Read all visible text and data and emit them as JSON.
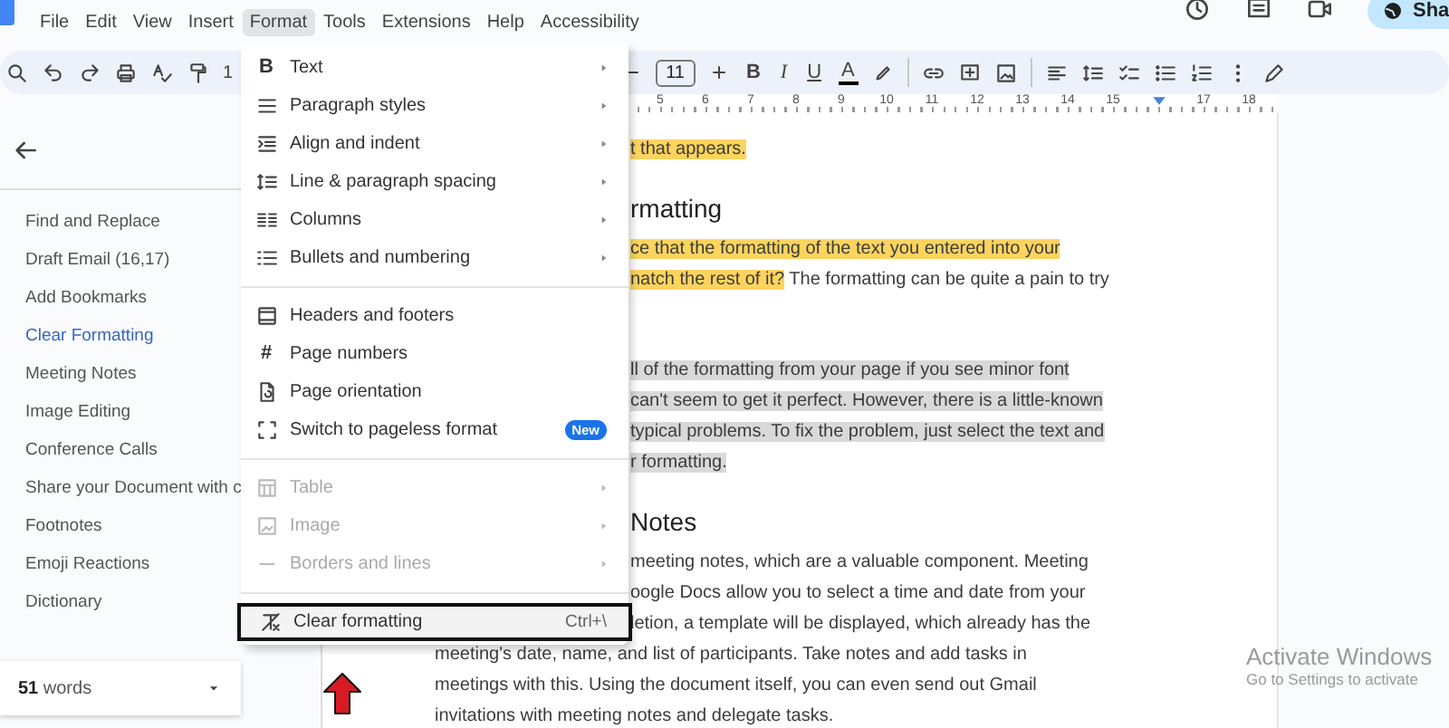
{
  "menubar": [
    {
      "label": "File",
      "selected": false
    },
    {
      "label": "Edit",
      "selected": false
    },
    {
      "label": "View",
      "selected": false
    },
    {
      "label": "Insert",
      "selected": false
    },
    {
      "label": "Format",
      "selected": true
    },
    {
      "label": "Tools",
      "selected": false
    },
    {
      "label": "Extensions",
      "selected": false
    },
    {
      "label": "Help",
      "selected": false
    },
    {
      "label": "Accessibility",
      "selected": false
    }
  ],
  "share": {
    "label": "Sha"
  },
  "toolbar": {
    "zoom": "1",
    "font_size": "11",
    "format_buttons": [
      "B",
      "I",
      "U",
      "A"
    ]
  },
  "ruler": [
    {
      "kind": "number",
      "label": "5"
    },
    {
      "kind": "number",
      "label": "6"
    },
    {
      "kind": "number",
      "label": "7"
    },
    {
      "kind": "number",
      "label": "8"
    },
    {
      "kind": "number",
      "label": "9"
    },
    {
      "kind": "number",
      "label": "10"
    },
    {
      "kind": "number",
      "label": "11"
    },
    {
      "kind": "number",
      "label": "12"
    },
    {
      "kind": "number",
      "label": "13"
    },
    {
      "kind": "number",
      "label": "14"
    },
    {
      "kind": "number",
      "label": "15"
    },
    {
      "kind": "marker"
    },
    {
      "kind": "number",
      "label": "17"
    },
    {
      "kind": "number",
      "label": "18"
    }
  ],
  "sidebar": {
    "items": [
      {
        "label": "Find and Replace",
        "selected": false
      },
      {
        "label": "Draft Email (16,17)",
        "selected": false
      },
      {
        "label": "Add Bookmarks",
        "selected": false
      },
      {
        "label": "Clear Formatting",
        "selected": true
      },
      {
        "label": "Meeting Notes",
        "selected": false
      },
      {
        "label": "Image Editing",
        "selected": false
      },
      {
        "label": "Conference Calls",
        "selected": false
      },
      {
        "label": "Share your Document with c",
        "selected": false
      },
      {
        "label": "Footnotes",
        "selected": false
      },
      {
        "label": "Emoji Reactions",
        "selected": false
      },
      {
        "label": "Dictionary",
        "selected": false
      }
    ],
    "word_count": "**51** words"
  },
  "document": {
    "beside_menu": [
      {
        "kind": "paragraph",
        "lines": [
          [
            {
              "text": "t that appears.",
              "highlighted": true,
              "selected": false
            }
          ]
        ]
      },
      {
        "kind": "heading",
        "lines": [
          [
            {
              "text": "rmatting",
              "highlighted": false,
              "selected": false
            }
          ]
        ]
      },
      {
        "kind": "paragraph",
        "lines": [
          [
            {
              "text": "ce that the formatting of the text you entered into your",
              "highlighted": true,
              "selected": false
            }
          ],
          [
            {
              "text": "natch the rest of it?",
              "highlighted": true,
              "selected": false
            },
            {
              "text": " The formatting can be quite a pain to try",
              "highlighted": false,
              "selected": false
            }
          ]
        ]
      },
      {
        "kind": "paragraph",
        "lines": [
          [
            {
              "text": "ll of the formatting from your page if you see minor font",
              "highlighted": false,
              "selected": true
            }
          ],
          [
            {
              "text": "can't seem to get it perfect. However, there is a little-known",
              "highlighted": false,
              "selected": true
            }
          ],
          [
            {
              "text": "typical problems. To fix the problem, just select the text and",
              "highlighted": false,
              "selected": true
            }
          ],
          [
            {
              "text": "r formatting.",
              "highlighted": false,
              "selected": true
            }
          ]
        ]
      },
      {
        "kind": "heading",
        "lines": [
          [
            {
              "text": "Notes",
              "highlighted": false,
              "selected": false
            }
          ]
        ]
      },
      {
        "kind": "paragraph",
        "lines": [
          [
            {
              "text": "meeting notes, which are a valuable component. Meeting",
              "highlighted": false,
              "selected": false
            }
          ],
          [
            {
              "text": "oogle Docs allow you to select a time and date from your",
              "highlighted": false,
              "selected": false
            }
          ],
          [
            {
              "text": "letion, a template will be displayed, which already has the",
              "highlighted": false,
              "selected": false
            }
          ]
        ]
      }
    ],
    "below_menu": [
      {
        "kind": "paragraph",
        "lines": [
          [
            {
              "text": "meeting's date, name, and list of participants. Take notes and add tasks in",
              "highlighted": false,
              "selected": false
            }
          ],
          [
            {
              "text": "meetings with this. Using the document itself, you can even send out Gmail",
              "highlighted": false,
              "selected": false
            }
          ],
          [
            {
              "text": "invitations with meeting notes and delegate tasks.",
              "highlighted": false,
              "selected": false
            }
          ]
        ]
      }
    ]
  },
  "format_menu": {
    "groups": [
      [
        {
          "label": "Text",
          "glyph": "B",
          "submenu": true,
          "disabled": false,
          "annotated": false
        },
        {
          "label": "Paragraph styles",
          "submenu": true,
          "disabled": false,
          "annotated": false
        },
        {
          "label": "Align and indent",
          "submenu": true,
          "disabled": false,
          "annotated": false
        },
        {
          "label": "Line & paragraph spacing",
          "submenu": true,
          "disabled": false,
          "annotated": false
        },
        {
          "label": "Columns",
          "submenu": true,
          "disabled": false,
          "annotated": false
        },
        {
          "label": "Bullets and numbering",
          "submenu": true,
          "disabled": false,
          "annotated": false
        }
      ],
      [
        {
          "label": "Headers and footers",
          "submenu": false,
          "disabled": false,
          "annotated": false
        },
        {
          "label": "Page numbers",
          "glyph": "#",
          "submenu": false,
          "disabled": false,
          "annotated": false
        },
        {
          "label": "Page orientation",
          "submenu": false,
          "disabled": false,
          "annotated": false
        },
        {
          "label": "Switch to pageless format",
          "badge": "New",
          "submenu": false,
          "disabled": false,
          "annotated": false
        }
      ],
      [
        {
          "label": "Table",
          "submenu": true,
          "disabled": true,
          "annotated": false
        },
        {
          "label": "Image",
          "submenu": true,
          "disabled": true,
          "annotated": false
        },
        {
          "label": "Borders and lines",
          "submenu": true,
          "disabled": true,
          "annotated": false
        }
      ],
      [
        {
          "label": "Clear formatting",
          "shortcut": "Ctrl+\\",
          "submenu": false,
          "disabled": false,
          "annotated": true
        }
      ]
    ]
  },
  "os_notice": {
    "title": "Activate Windows",
    "subtitle": "Go to Settings to activate"
  }
}
